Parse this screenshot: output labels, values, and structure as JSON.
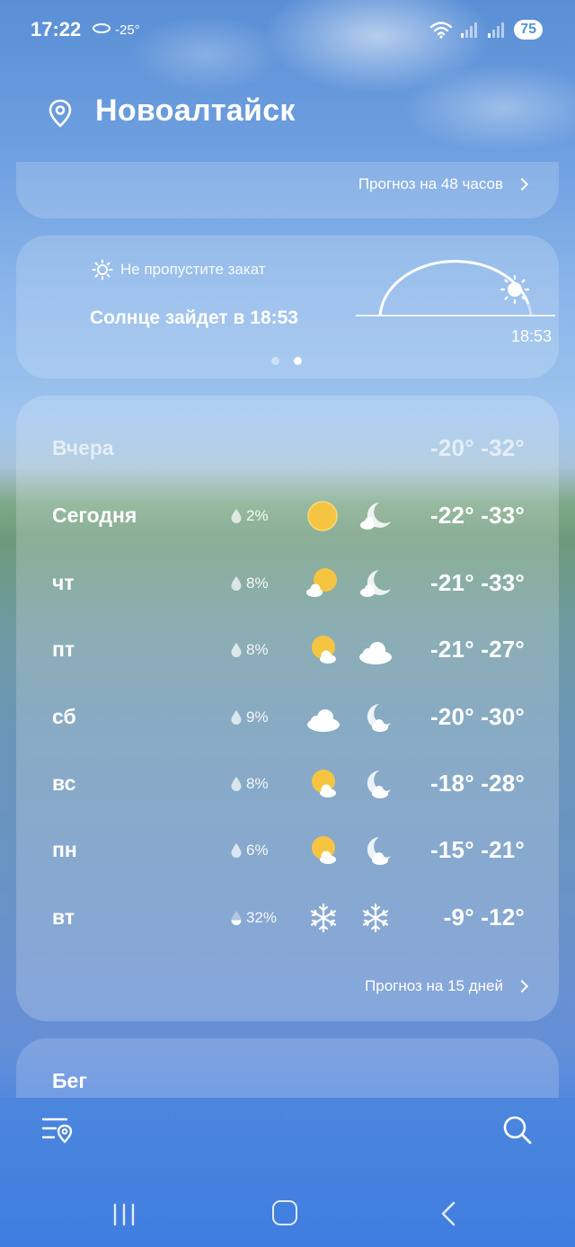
{
  "status_bar": {
    "time": "17:22",
    "temp_indicator": "-25°",
    "battery": "75"
  },
  "header": {
    "city": "Новоалтайск"
  },
  "hourly_card": {
    "link_label": "Прогноз на 48 часов"
  },
  "sunset_card": {
    "subtitle": "Не пропустите закат",
    "main_text": "Солнце зайдет в 18:53",
    "time_label": "18:53",
    "page_index": 2,
    "page_count": 2
  },
  "forecast": {
    "rows": [
      {
        "day": "Вчера",
        "precip": "",
        "icon_day": "",
        "icon_night": "",
        "temps": "-20° -32°"
      },
      {
        "day": "Сегодня",
        "precip": "2%",
        "icon_day": "sun-icon",
        "icon_night": "moon-cloud-icon",
        "temps": "-22° -33°"
      },
      {
        "day": "чт",
        "precip": "8%",
        "icon_day": "sun-cloud-icon",
        "icon_night": "moon-cloud-icon",
        "temps": "-21° -33°"
      },
      {
        "day": "пт",
        "precip": "8%",
        "icon_day": "sun-cloud-icon",
        "icon_night": "cloud-icon",
        "temps": "-21° -27°"
      },
      {
        "day": "сб",
        "precip": "9%",
        "icon_day": "cloud-icon",
        "icon_night": "moon-cloud-icon",
        "temps": "-20° -30°"
      },
      {
        "day": "вс",
        "precip": "8%",
        "icon_day": "sun-cloud-icon",
        "icon_night": "moon-cloud-icon",
        "temps": "-18° -28°"
      },
      {
        "day": "пн",
        "precip": "6%",
        "icon_day": "sun-cloud-icon",
        "icon_night": "moon-cloud-icon",
        "temps": "-15° -21°"
      },
      {
        "day": "вт",
        "precip": "32%",
        "icon_day": "snowflake-icon",
        "icon_night": "snowflake-icon",
        "temps": "-9° -12°"
      }
    ],
    "link_label": "Прогноз на 15 дней"
  },
  "running_card": {
    "title": "Бег"
  },
  "colors": {
    "sun": "#f5c542",
    "cloud": "#ffffff"
  }
}
